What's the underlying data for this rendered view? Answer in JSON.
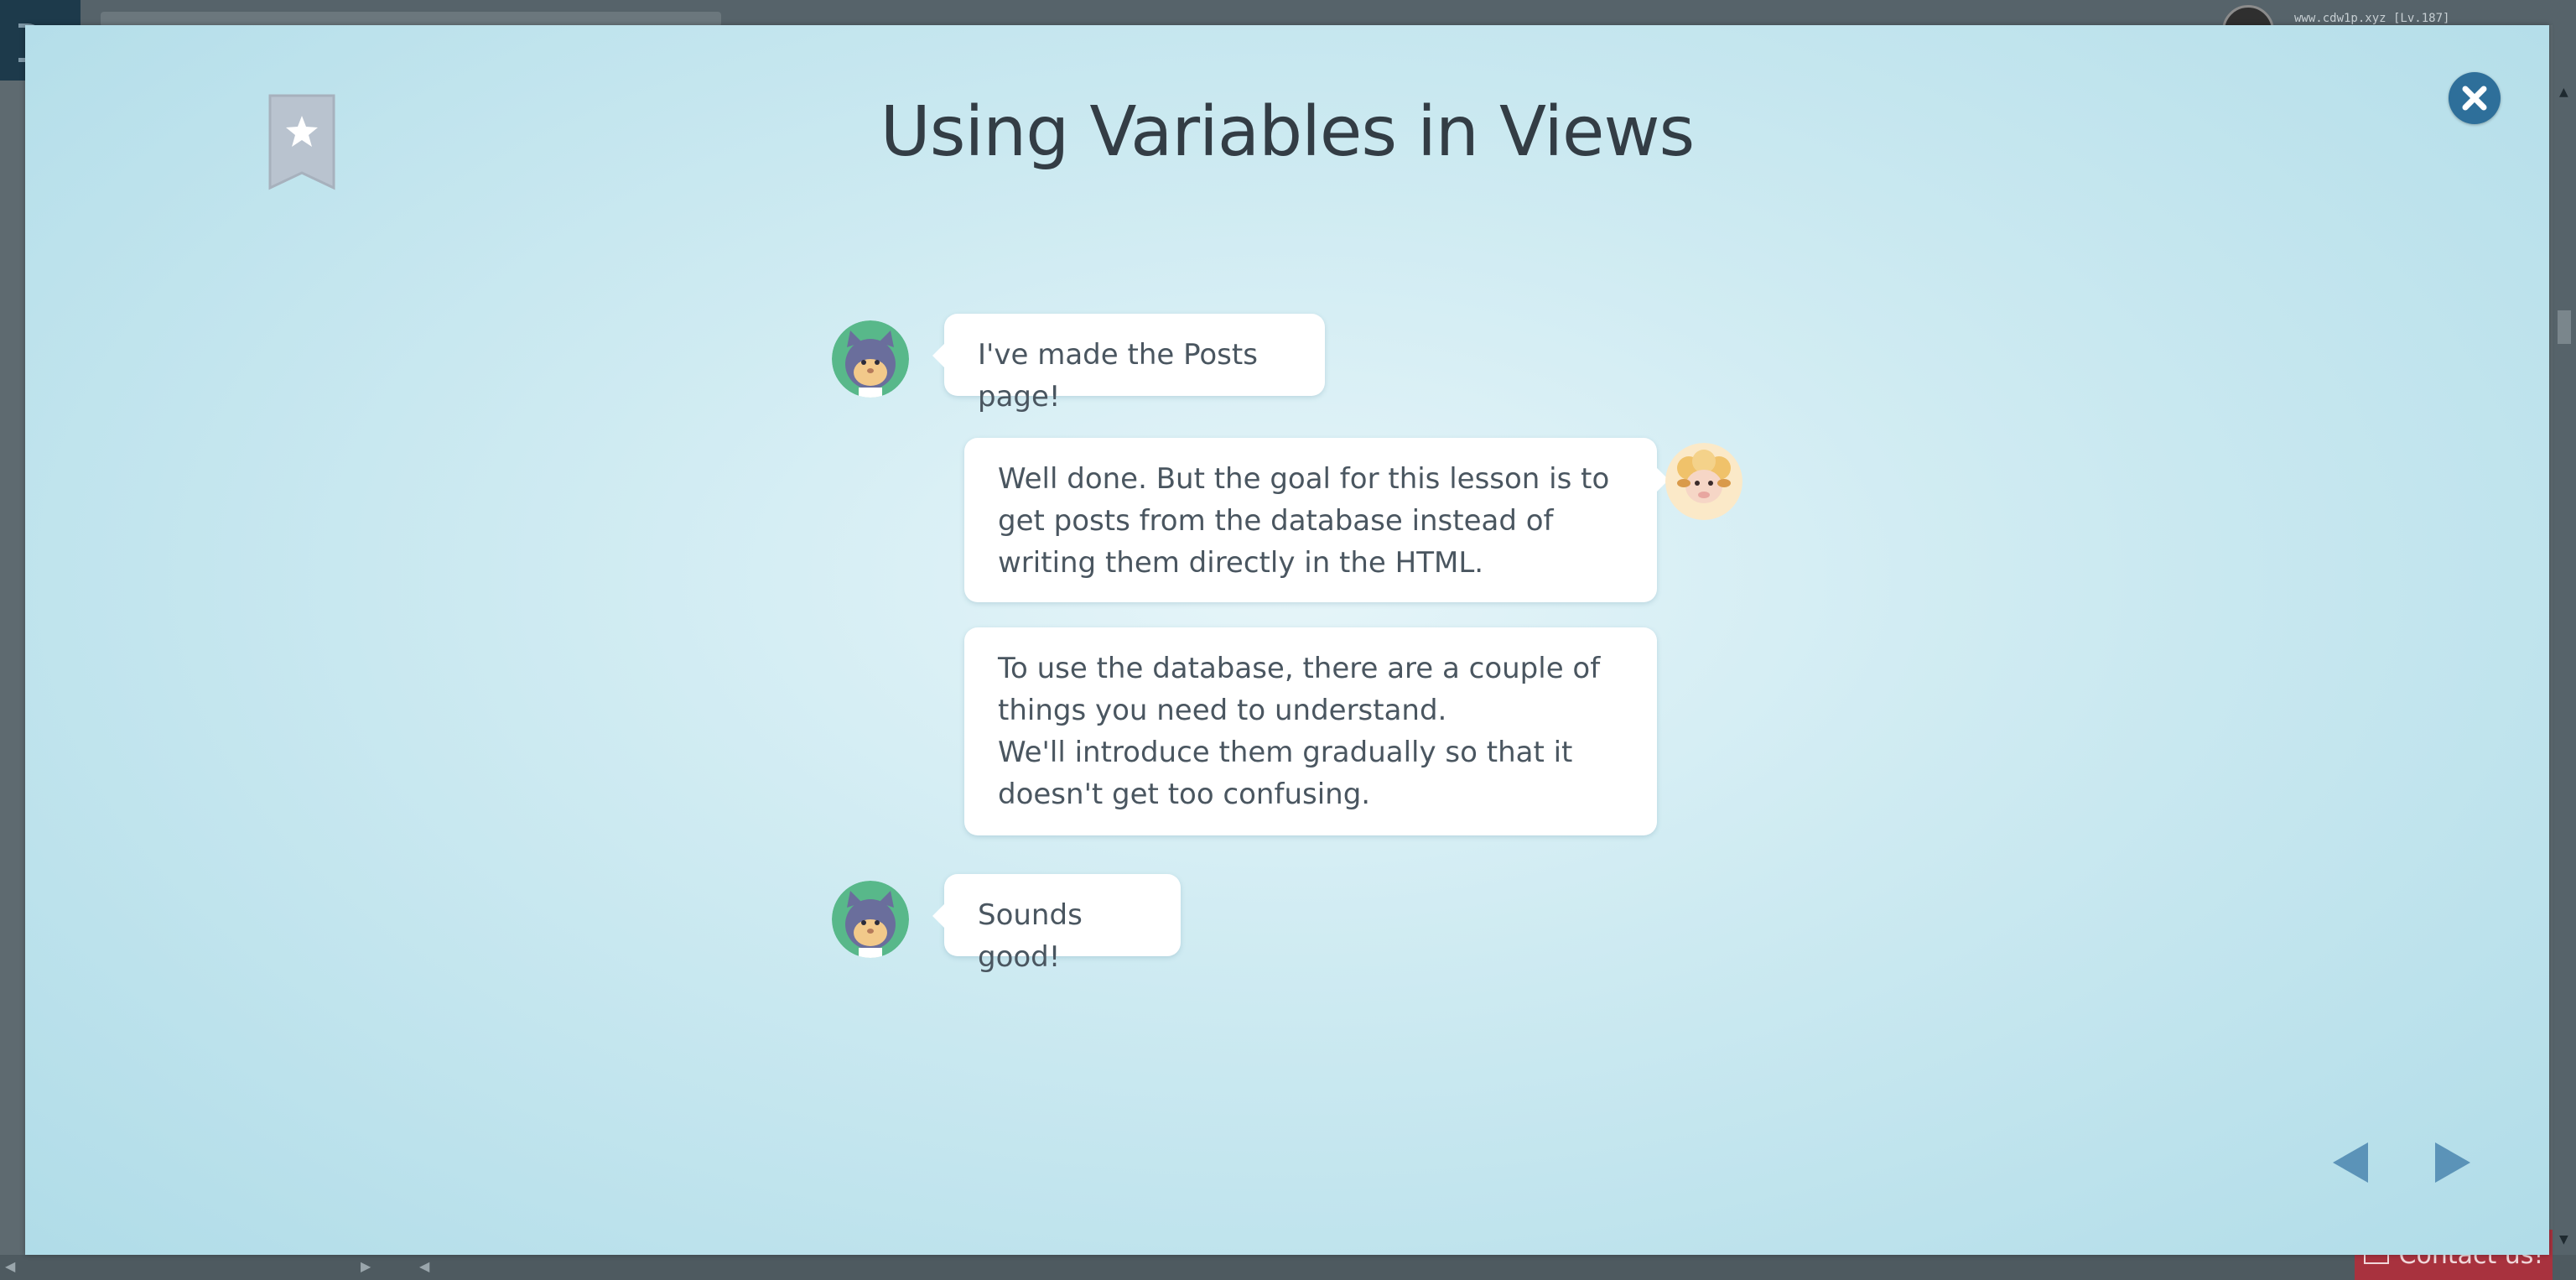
{
  "background": {
    "url_text": "www.cdw1p.xyz [Lv.187]",
    "contact_label": "Contact us!"
  },
  "modal": {
    "title": "Using Variables in Views",
    "icons": {
      "bookmark": "bookmark-star-icon",
      "close": "close-icon",
      "prev": "previous-arrow-icon",
      "next": "next-arrow-icon"
    },
    "messages": [
      {
        "speaker": "cat",
        "side": "left",
        "lines": [
          "I've made the Posts page!"
        ]
      },
      {
        "speaker": "sheep",
        "side": "right",
        "lines": [
          "Well done. But the goal for this lesson is to get posts from the database instead of writing them directly in the HTML."
        ]
      },
      {
        "speaker": "sheep",
        "side": "right",
        "lines": [
          "To use the database, there are a couple of things you need to understand.",
          "We'll introduce them gradually so that it doesn't get too confusing."
        ]
      },
      {
        "speaker": "cat",
        "side": "left",
        "lines": [
          "Sounds good!"
        ]
      }
    ]
  },
  "colors": {
    "accent": "#2e6f9a",
    "title_text": "#333d45",
    "bubble_text": "#4a5660",
    "nav_arrow": "#5b93b8",
    "bookmark": "#b9c3cf"
  }
}
